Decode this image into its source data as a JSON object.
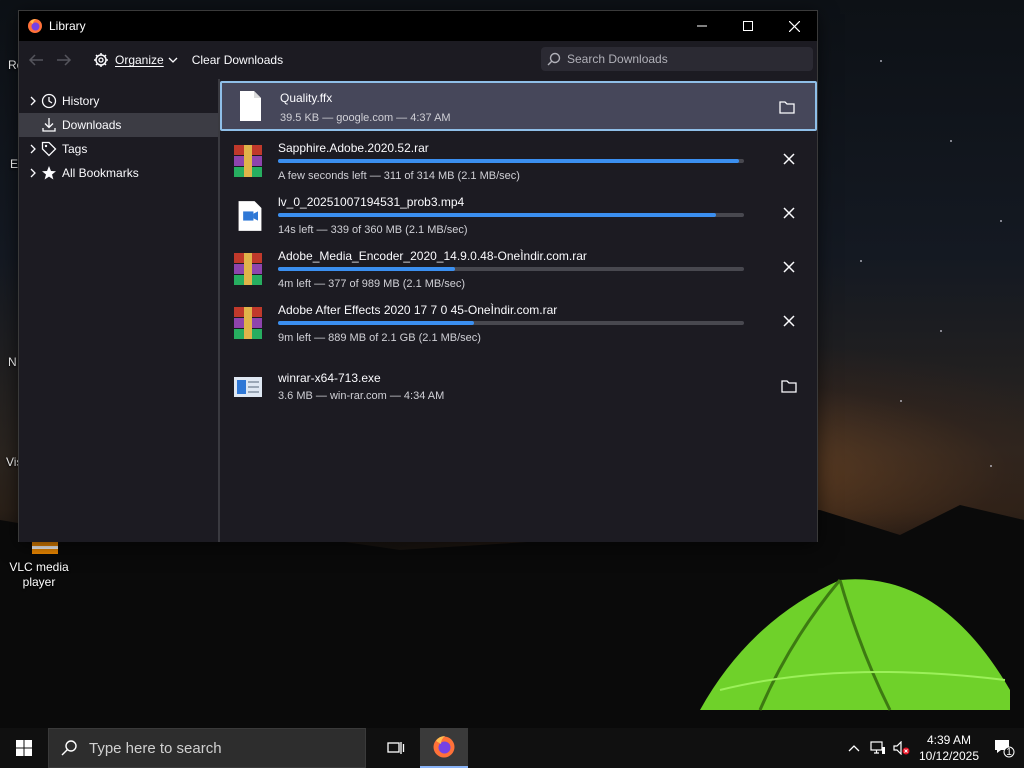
{
  "desktop": {
    "icon_label": "VLC media player",
    "fragments": [
      "Re",
      "E",
      "N",
      "Vis"
    ]
  },
  "window": {
    "title": "Library",
    "toolbar": {
      "organize_label": "Organize",
      "clear_label": "Clear Downloads",
      "search_placeholder": "Search Downloads"
    },
    "sidebar": {
      "items": [
        {
          "label": "History",
          "icon": "history-icon",
          "expanded": false
        },
        {
          "label": "Downloads",
          "icon": "download-icon",
          "selected": true
        },
        {
          "label": "Tags",
          "icon": "tag-icon",
          "expanded": false
        },
        {
          "label": "All Bookmarks",
          "icon": "star-icon",
          "expanded": false
        }
      ]
    },
    "downloads": [
      {
        "name": "Quality.ffx",
        "status": "39.5 KB — google.com — 4:37 AM",
        "icon": "file-icon",
        "state": "complete",
        "selected": true
      },
      {
        "name": "Sapphire.Adobe.2020.52.rar",
        "status": "A few seconds left — 311 of 314 MB (2.1 MB/sec)",
        "icon": "winrar-archive-icon",
        "state": "downloading",
        "progress": 0.99
      },
      {
        "name": "lv_0_20251007194531_prob3.mp4",
        "status": "14s left — 339 of 360 MB (2.1 MB/sec)",
        "icon": "video-file-icon",
        "state": "downloading",
        "progress": 0.94
      },
      {
        "name": "Adobe_Media_Encoder_2020_14.9.0.48-OneÌndir.com.rar",
        "status": "4m left — 377 of 989 MB (2.1 MB/sec)",
        "icon": "winrar-archive-icon",
        "state": "downloading",
        "progress": 0.38
      },
      {
        "name": "Adobe After Effects 2020 17 7 0 45-OneÌndir.com.rar",
        "status": "9m left — 889 MB of 2.1 GB (2.1 MB/sec)",
        "icon": "winrar-archive-icon",
        "state": "downloading",
        "progress": 0.42
      },
      {
        "name": "winrar-x64-713.exe",
        "status": "3.6 MB — win-rar.com — 4:34 AM",
        "icon": "installer-icon",
        "state": "complete"
      }
    ]
  },
  "taskbar": {
    "search_placeholder": "Type here to search",
    "time": "4:39 AM",
    "date": "10/12/2025",
    "notification_count": "1"
  },
  "colors": {
    "accent": "#3b8ff0",
    "window_bg": "#1c1b22",
    "selected_item_bg": "#46475a",
    "selected_border": "#8fbfe8"
  }
}
